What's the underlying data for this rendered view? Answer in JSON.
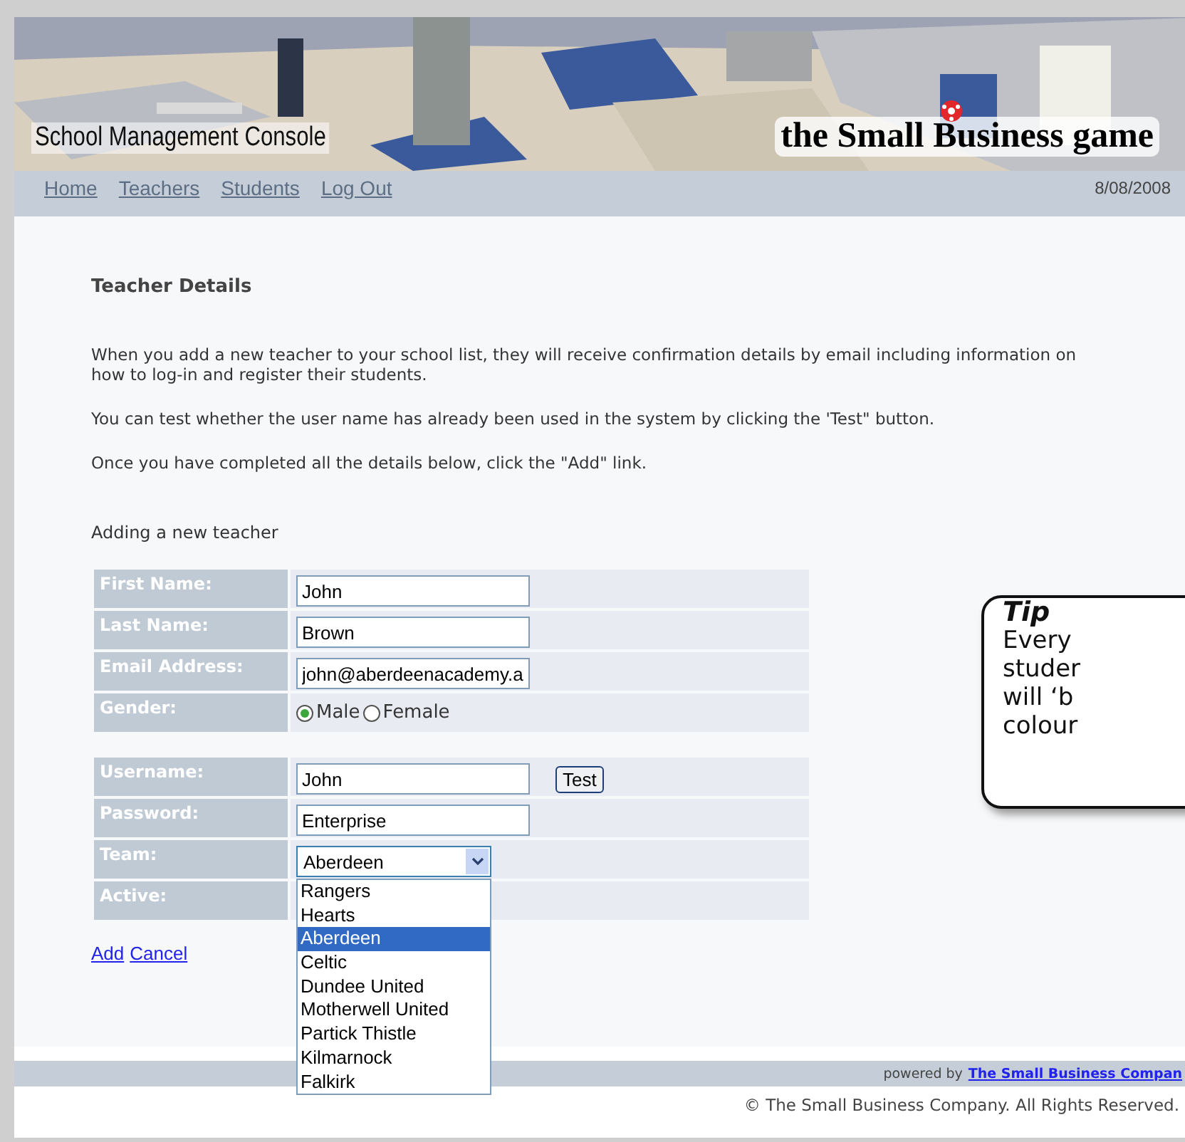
{
  "header": {
    "title": "School Management Console",
    "brand": "the Small Business game"
  },
  "nav": {
    "links": [
      {
        "label": "Home"
      },
      {
        "label": "Teachers"
      },
      {
        "label": "Students"
      },
      {
        "label": "Log Out"
      }
    ],
    "date": "8/08/2008"
  },
  "heading": "Teacher Details",
  "paragraphs": [
    "When you add a new teacher to your school list, they will receive confirmation details by email including information on how to log-in and register their students.",
    "You can test whether the user name has already been used in the system by clicking the 'Test\" button.",
    "Once you have completed all the details below, click the \"Add\" link."
  ],
  "subheading": "Adding a new teacher",
  "form": {
    "groups": [
      [
        {
          "label": "First Name:",
          "kind": "text",
          "value": "John"
        },
        {
          "label": "Last Name:",
          "kind": "text",
          "value": "Brown"
        },
        {
          "label": "Email Address:",
          "kind": "text",
          "value": "john@aberdeenacademy.a"
        },
        {
          "label": "Gender:",
          "kind": "radio",
          "options": [
            {
              "label": "Male",
              "selected": true
            },
            {
              "label": "Female",
              "selected": false
            }
          ]
        }
      ],
      [
        {
          "label": "Username:",
          "kind": "text_button",
          "value": "John",
          "button": "Test"
        },
        {
          "label": "Password:",
          "kind": "text",
          "value": "Enterprise"
        },
        {
          "label": "Team:",
          "kind": "select",
          "value": "Aberdeen",
          "expanded": true,
          "options": [
            {
              "label": "Rangers",
              "selected": false
            },
            {
              "label": "Hearts",
              "selected": false
            },
            {
              "label": "Aberdeen",
              "selected": true
            },
            {
              "label": "Celtic",
              "selected": false
            },
            {
              "label": "Dundee United",
              "selected": false
            },
            {
              "label": "Motherwell United",
              "selected": false
            },
            {
              "label": "Partick Thistle",
              "selected": false
            },
            {
              "label": "Kilmarnock",
              "selected": false
            },
            {
              "label": "Falkirk",
              "selected": false
            }
          ]
        },
        {
          "label": "Active:",
          "kind": "blank"
        }
      ]
    ]
  },
  "actions": [
    {
      "label": "Add"
    },
    {
      "label": "Cancel"
    }
  ],
  "tip": {
    "title": "Tip",
    "lines": [
      "Every",
      "studer",
      "will ‘b",
      "colour"
    ]
  },
  "footer": {
    "powered_by": "powered by",
    "link": "The Small Business Compan",
    "copyright": "© The Small Business Company. All Rights Reserved."
  }
}
